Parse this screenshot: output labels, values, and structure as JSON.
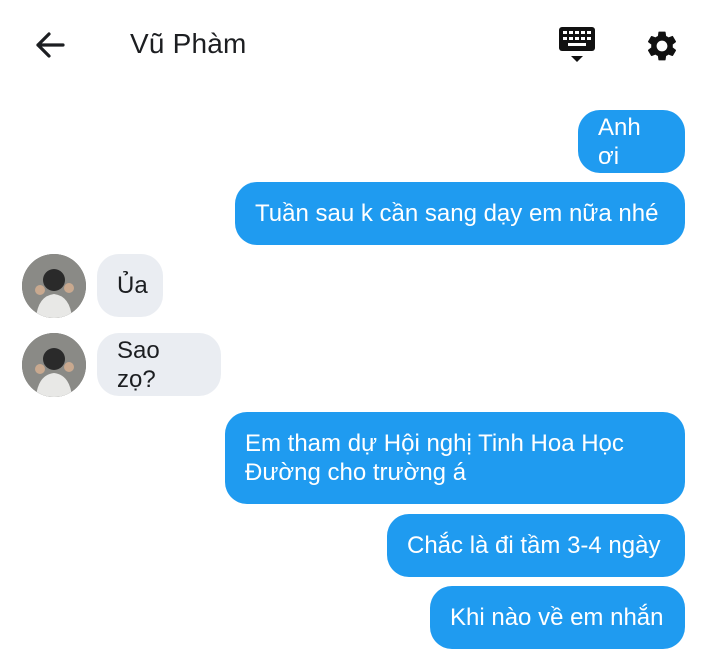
{
  "header": {
    "title": "Vũ Phàm",
    "back_icon": "arrow-left-icon",
    "keyboard_icon": "keyboard-icon",
    "settings_icon": "gear-icon"
  },
  "colors": {
    "outgoing_bubble": "#1f9bf0",
    "incoming_bubble": "#eaedf2",
    "text_dark": "#1c1e21"
  },
  "messages": [
    {
      "side": "out",
      "text": "Anh ơi"
    },
    {
      "side": "out",
      "text": "Tuần sau k cần sang dạy em nữa nhé"
    },
    {
      "side": "in",
      "text": "Ủa"
    },
    {
      "side": "in",
      "text": "Sao zọ?"
    },
    {
      "side": "out",
      "line1": "Em tham dự Hội nghị Tinh Hoa Học",
      "line2": "Đường cho trường á"
    },
    {
      "side": "out",
      "text": "Chắc là đi tầm 3-4 ngày"
    },
    {
      "side": "out",
      "text": "Khi nào về em nhắn"
    }
  ]
}
